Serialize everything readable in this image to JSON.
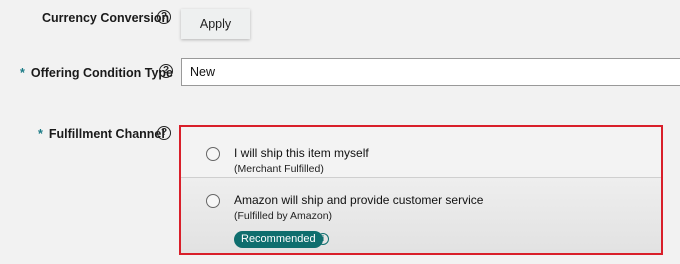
{
  "currency_conversion": {
    "label": "Currency Conversion",
    "help_icon": "question-circle-icon",
    "apply_label": "Apply"
  },
  "offering_condition": {
    "required_marker": "*",
    "label": "Offering Condition Type",
    "help_icon": "question-circle-icon",
    "value": "New"
  },
  "fulfillment_channel": {
    "required_marker": "*",
    "label": "Fulfillment Channel",
    "help_icon": "question-circle-icon",
    "highlight_color": "#d91f2a",
    "options": [
      {
        "title": "I will ship this item myself",
        "subtitle": "(Merchant Fulfilled)",
        "selected": false
      },
      {
        "title": "Amazon will ship and provide customer service",
        "subtitle": "(Fulfilled by Amazon)",
        "selected": false,
        "badge": "Recommended",
        "badge_color": "#0f6e6e",
        "info_icon": "info-circle-icon"
      }
    ]
  }
}
